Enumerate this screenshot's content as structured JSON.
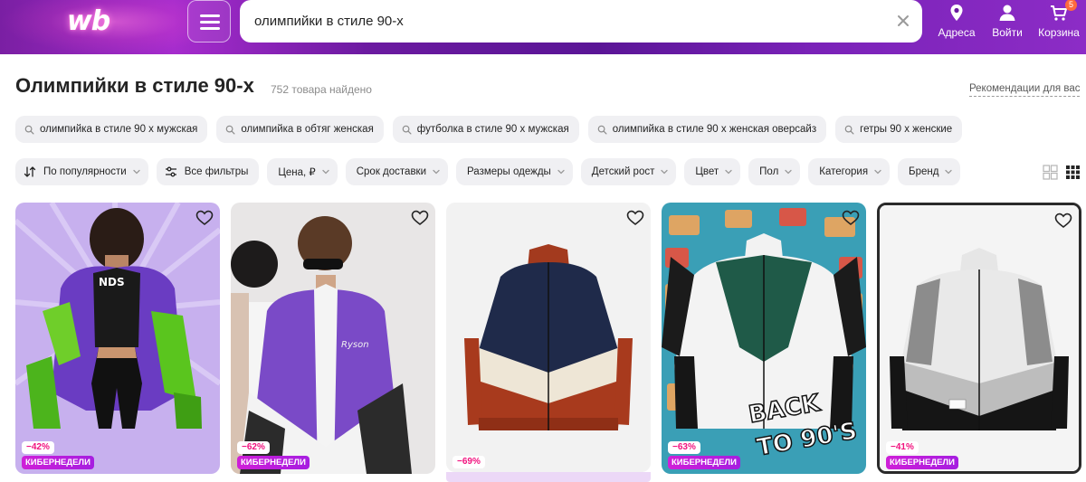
{
  "header": {
    "logo": "wb",
    "search_value": "олимпийки в стиле 90-х",
    "address_label": "Адреса",
    "login_label": "Войти",
    "cart_label": "Корзина",
    "cart_count": "5"
  },
  "page": {
    "title": "Олимпийки в стиле 90-х",
    "count": "752 товара найдено",
    "recommendations": "Рекомендации для вас"
  },
  "suggestions": [
    "олимпийка в стиле 90 х мужская",
    "олимпийка в обтяг женская",
    "футболка в стиле 90 х мужская",
    "олимпийка в стиле 90 х женская оверсайз",
    "гетры 90 х женские"
  ],
  "filters": [
    "По популярности",
    "Все фильтры",
    "Цена, ₽",
    "Срок доставки",
    "Размеры одежды",
    "Детский рост",
    "Цвет",
    "Пол",
    "Категория",
    "Бренд"
  ],
  "products": [
    {
      "discount": "−42%",
      "badge": "КИБЕРНЕДЕЛИ"
    },
    {
      "discount": "−62%",
      "badge": "КИБЕРНЕДЕЛИ"
    },
    {
      "discount": "−69%",
      "badge": ""
    },
    {
      "discount": "−63%",
      "badge": "КИБЕРНЕДЕЛИ",
      "print": "BACK TO 90'S"
    },
    {
      "discount": "−41%",
      "badge": "КИБЕРНЕДЕЛИ"
    }
  ],
  "colors": {
    "header_purple": "#6b1aa0",
    "discount_pink": "#f1117e",
    "badge_purple": "#cf1fd8",
    "chip_bg": "#f0f0f3"
  },
  "icons": [
    "menu-icon",
    "clear-icon",
    "location-icon",
    "user-icon",
    "cart-icon",
    "search-icon",
    "sort-icon",
    "filter-icon",
    "chevron-down-icon",
    "grid-large-icon",
    "grid-small-icon",
    "heart-icon"
  ]
}
